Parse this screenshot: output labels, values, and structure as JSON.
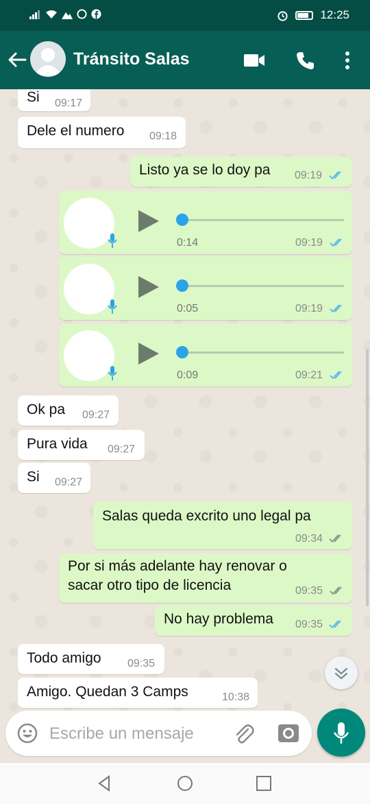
{
  "status_bar": {
    "time": "12:25"
  },
  "header": {
    "contact_name": "Tránsito Salas",
    "icons": [
      "back-arrow-icon",
      "avatar",
      "video-call-icon",
      "phone-icon",
      "more-vert-icon"
    ]
  },
  "messages": [
    {
      "dir": "in",
      "text": "Si",
      "time": "09:17"
    },
    {
      "dir": "in",
      "text": "Dele el numero",
      "time": "09:18"
    },
    {
      "dir": "out",
      "text": "Listo ya se lo doy pa",
      "time": "09:19",
      "status": "read"
    },
    {
      "dir": "out",
      "type": "voice",
      "duration": "0:14",
      "time": "09:19",
      "status": "read"
    },
    {
      "dir": "out",
      "type": "voice",
      "duration": "0:05",
      "time": "09:19",
      "status": "read"
    },
    {
      "dir": "out",
      "type": "voice",
      "duration": "0:09",
      "time": "09:21",
      "status": "read"
    },
    {
      "dir": "in",
      "text": "Ok pa",
      "time": "09:27"
    },
    {
      "dir": "in",
      "text": "Pura vida",
      "time": "09:27"
    },
    {
      "dir": "in",
      "text": "Si",
      "time": "09:27"
    },
    {
      "dir": "out",
      "text": "Salas queda  excrito uno legal pa",
      "time": "09:34",
      "status": "delivered"
    },
    {
      "dir": "out",
      "text_lines": [
        "Por si más adelante hay renovar o",
        "sacar otro tipo de licencia"
      ],
      "time": "09:35",
      "status": "delivered"
    },
    {
      "dir": "out",
      "text": "No hay problema",
      "time": "09:35",
      "status": "read"
    },
    {
      "dir": "in",
      "text": "Todo amigo",
      "time": "09:35"
    },
    {
      "dir": "in",
      "text": "Amigo. Quedan 3 Camps",
      "time": "10:38"
    }
  ],
  "composer": {
    "placeholder": "Escribe un mensaje"
  },
  "colors": {
    "header": "#075e54",
    "status_bar": "#054d44",
    "outgoing": "#dcf8c6",
    "incoming": "#ffffff",
    "read_tick": "#4fb6ec",
    "fab": "#00897b"
  }
}
